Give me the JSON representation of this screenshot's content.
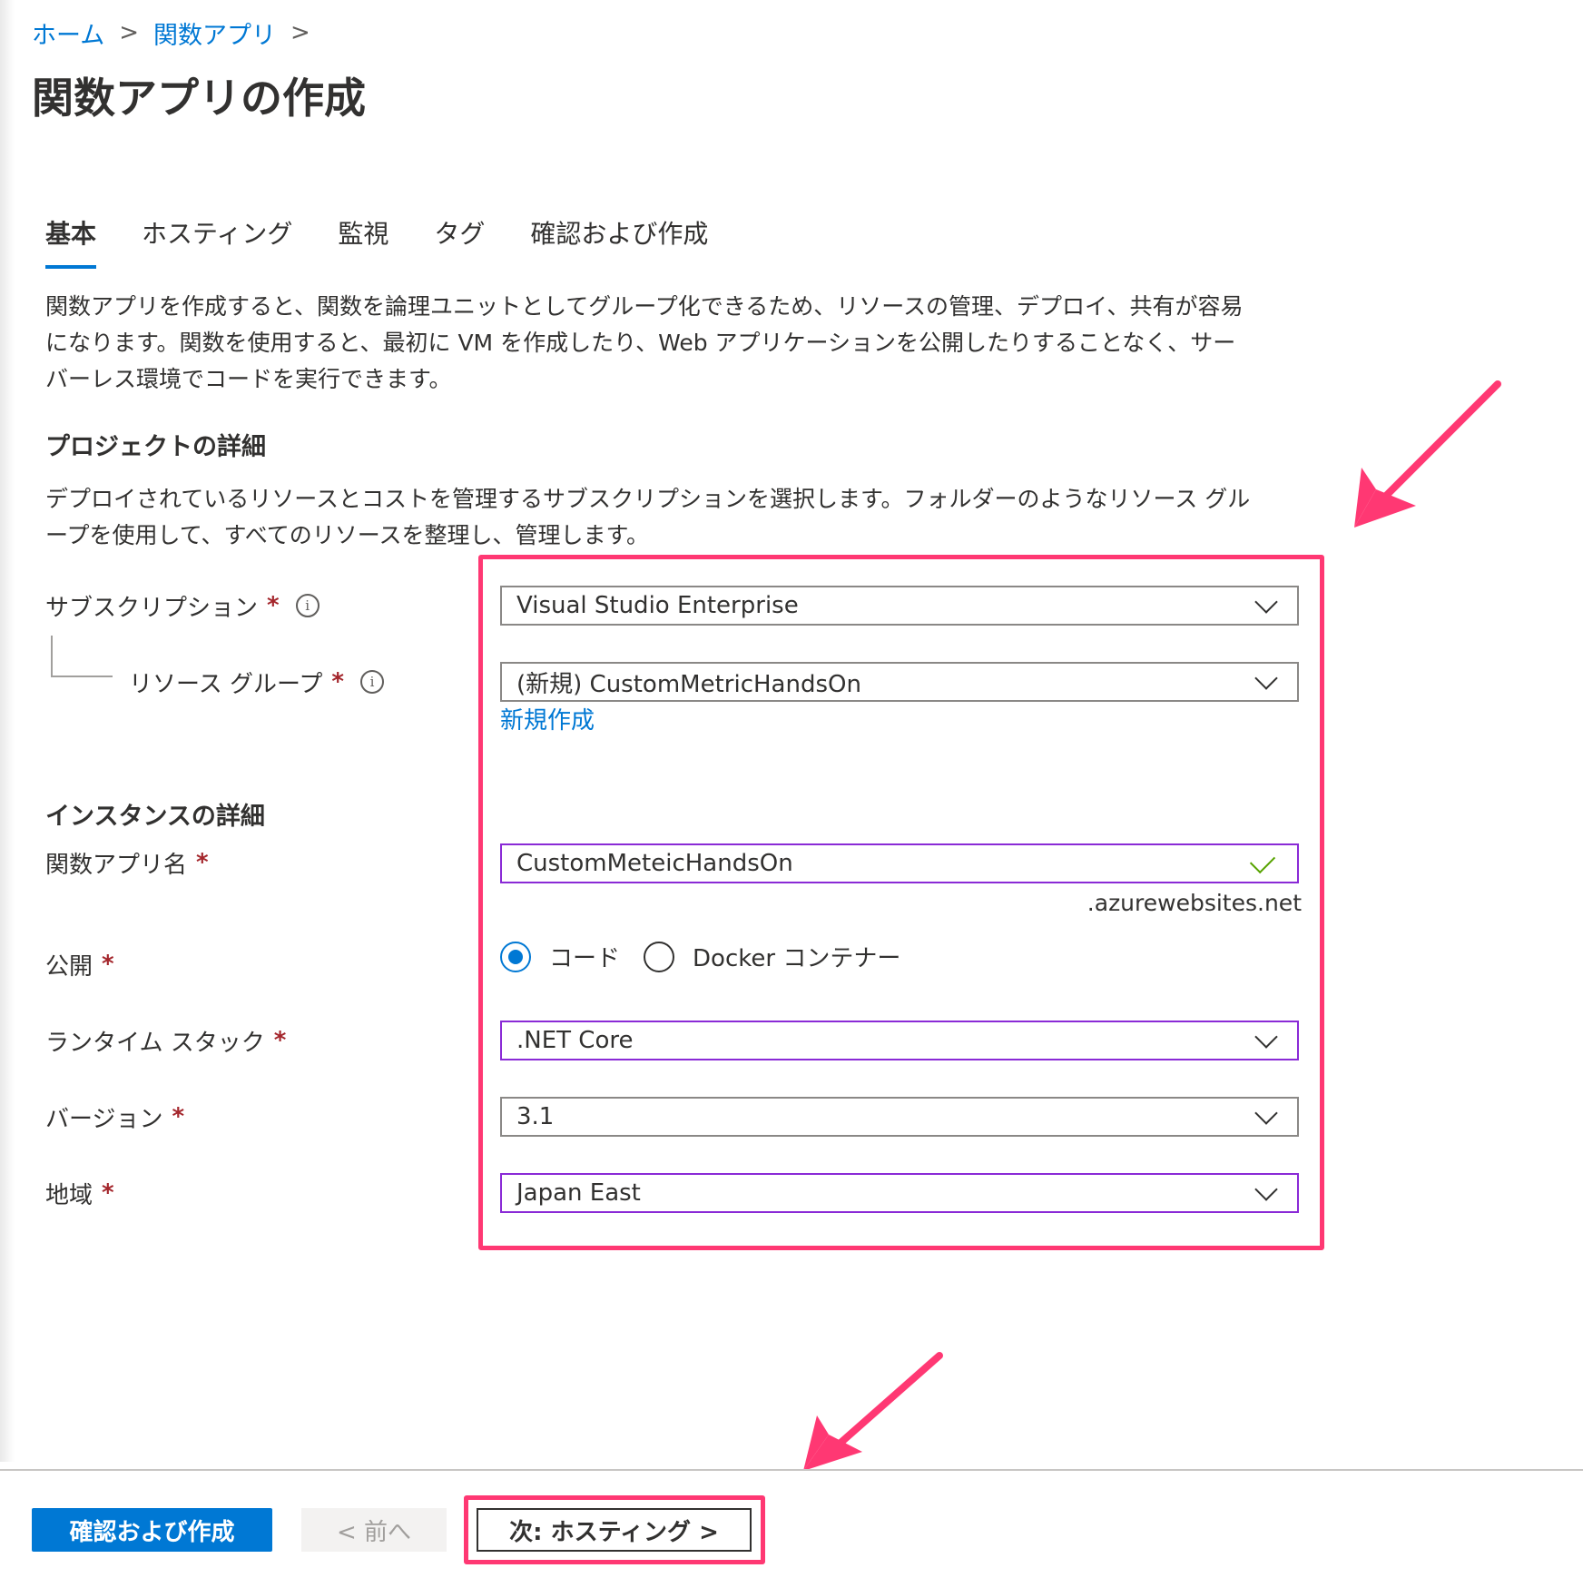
{
  "breadcrumb": {
    "home": "ホーム",
    "function_app": "関数アプリ",
    "separator": ">"
  },
  "page": {
    "title": "関数アプリの作成"
  },
  "tabs": [
    {
      "label": "基本",
      "active": true
    },
    {
      "label": "ホスティング",
      "active": false
    },
    {
      "label": "監視",
      "active": false
    },
    {
      "label": "タグ",
      "active": false
    },
    {
      "label": "確認および作成",
      "active": false
    }
  ],
  "intro": {
    "line1": "関数アプリを作成すると、関数を論理ユニットとしてグループ化できるため、リソースの管理、デプロイ、共有が容易",
    "line2": "になります。関数を使用すると、最初に VM を作成したり、Web アプリケーションを公開したりすることなく、サー",
    "line3": "バーレス環境でコードを実行できます。"
  },
  "project": {
    "heading": "プロジェクトの詳細",
    "line1": "デプロイされているリソースとコストを管理するサブスクリプションを選択します。フォルダーのようなリソース グル",
    "line2": "ープを使用して、すべてのリソースを整理し、管理します。",
    "subscription_label": "サブスクリプション",
    "subscription_value": "Visual Studio Enterprise",
    "resource_group_label": "リソース グループ",
    "resource_group_value": "(新規) CustomMetricHandsOn",
    "create_new_link": "新規作成"
  },
  "instance": {
    "heading": "インスタンスの詳細",
    "app_name_label": "関数アプリ名",
    "app_name_value": "CustomMeteicHandsOn",
    "domain_suffix": ".azurewebsites.net",
    "publish_label": "公開",
    "publish_options": [
      "コード",
      "Docker コンテナー"
    ],
    "publish_selected": "コード",
    "runtime_label": "ランタイム スタック",
    "runtime_value": ".NET Core",
    "version_label": "バージョン",
    "version_value": "3.1",
    "region_label": "地域",
    "region_value": "Japan East"
  },
  "required_marker": "*",
  "info_glyph": "i",
  "footer": {
    "review_create": "確認および作成",
    "previous": "< 前へ",
    "next": "次: ホスティング >"
  },
  "colors": {
    "accent": "#0078d4",
    "highlight": "#ff3873",
    "required": "#a4262c",
    "focus_border": "#8a2ad6",
    "valid_check": "#57a300"
  },
  "icons": [
    "chevron-right-icon",
    "info-icon",
    "chevron-down-icon",
    "checkmark-icon",
    "radio-icon",
    "annotation-arrow-icon"
  ]
}
